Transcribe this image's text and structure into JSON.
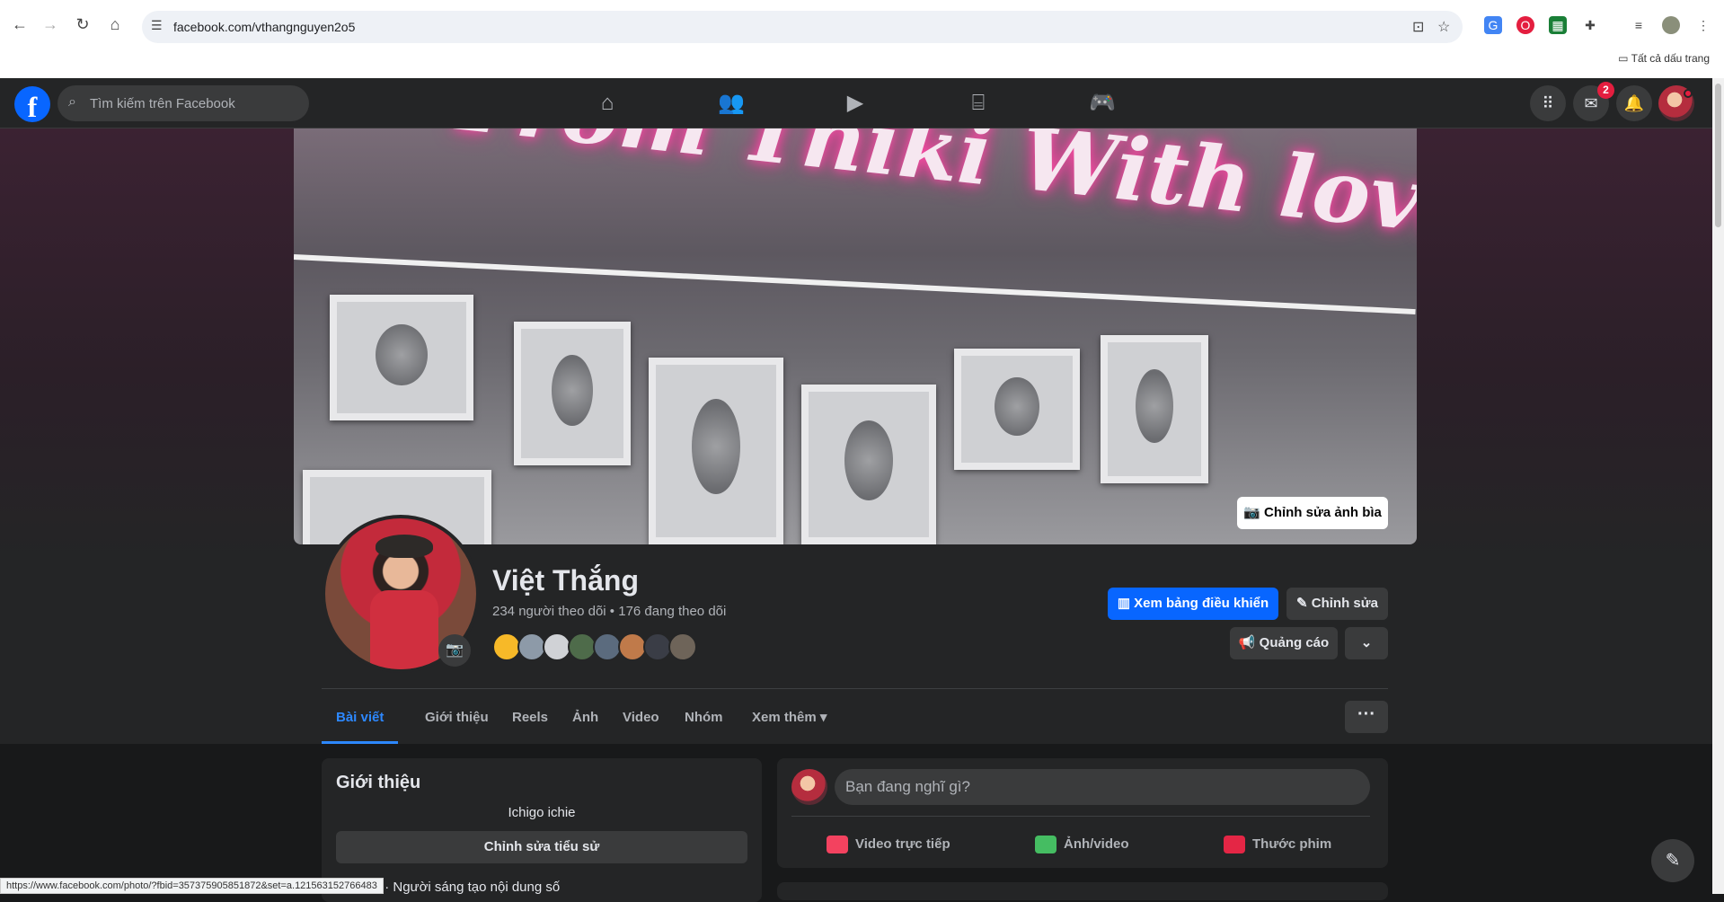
{
  "browser": {
    "url": "facebook.com/vthangnguyen2o5",
    "bookmarks_label": "Tất cả dấu trang"
  },
  "fb": {
    "search_placeholder": "Tìm kiếm trên Facebook",
    "messenger_badge": "2"
  },
  "cover": {
    "neon_text": "From Thiki With love",
    "edit_label": "Chỉnh sửa ảnh bìa"
  },
  "profile": {
    "name": "Việt Thắng",
    "stats": "234 người theo dõi • 176 đang theo dõi",
    "dashboard_label": "Xem bảng điều khiển",
    "edit_label": "Chỉnh sửa",
    "ads_label": "Quảng cáo"
  },
  "tabs": [
    {
      "label": "Bài viết",
      "active": true
    },
    {
      "label": "Giới thiệu"
    },
    {
      "label": "Reels"
    },
    {
      "label": "Ảnh"
    },
    {
      "label": "Video"
    },
    {
      "label": "Nhóm"
    },
    {
      "label": "Xem thêm"
    }
  ],
  "intro": {
    "title": "Giới thiệu",
    "bio": "Ichigo ichie",
    "edit_bio_label": "Chỉnh sửa tiểu sử",
    "line": "... nhân · Người sáng tạo nội dung số"
  },
  "composer": {
    "placeholder": "Bạn đang nghĩ gì?",
    "live": "Video trực tiếp",
    "photo": "Ảnh/video",
    "reel": "Thước phim"
  },
  "status_url": "https://www.facebook.com/photo/?fbid=357375905851872&set=a.121563152766483",
  "colors": {
    "accent": "#0866ff",
    "bg": "#18191a",
    "card": "#242526"
  }
}
